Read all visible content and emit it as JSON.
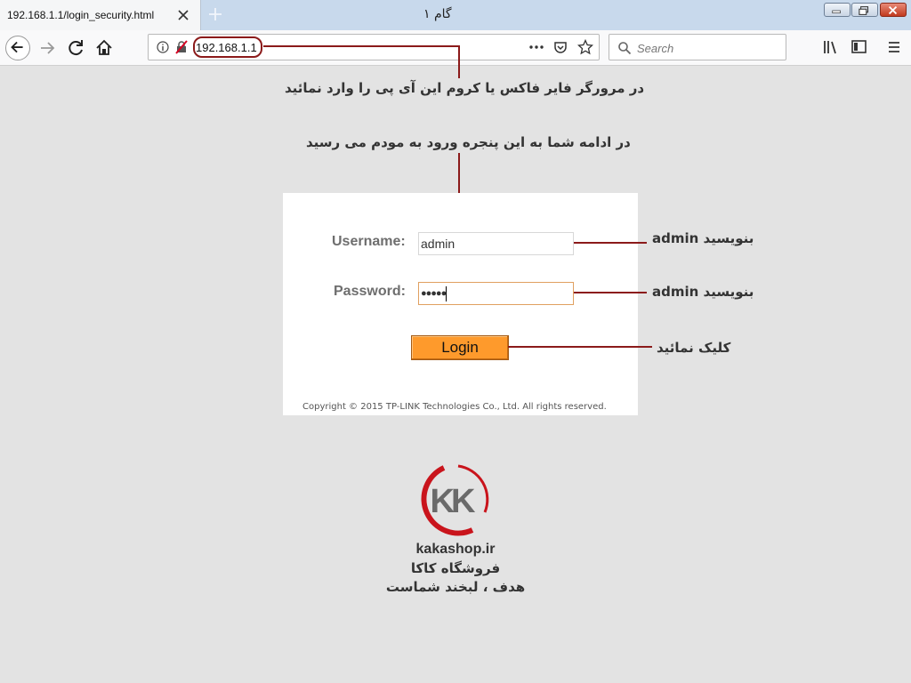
{
  "browser": {
    "tab_title": "192.168.1.1/login_security.html",
    "window_title": "گام ۱",
    "url": "192.168.1.1",
    "search_placeholder": "Search"
  },
  "annotations": {
    "address_hint": "در مرورگر فایر فاکس یا کروم این آی پی را وارد نمائید",
    "window_hint": "در ادامه شما به این پنجره ورود به مودم می رسید",
    "username_hint": "بنویسید admin",
    "password_hint": "بنویسید admin",
    "login_hint": "کلیک نمائید"
  },
  "login": {
    "username_label": "Username:",
    "username_value": "admin",
    "password_label": "Password:",
    "password_mask": "●●●●●",
    "button_label": "Login",
    "copyright": "Copyright © 2015 TP-LINK Technologies Co., Ltd. All rights reserved."
  },
  "brand": {
    "logo_text": "KK",
    "site": "kakashop.ir",
    "name": "فروشگاه کاکا",
    "slogan": "هدف ، لبخند شماست"
  },
  "colors": {
    "accent_dark_red": "#8b1a1a",
    "login_button": "#fe9a2c",
    "page_bg": "#e3e3e3"
  }
}
